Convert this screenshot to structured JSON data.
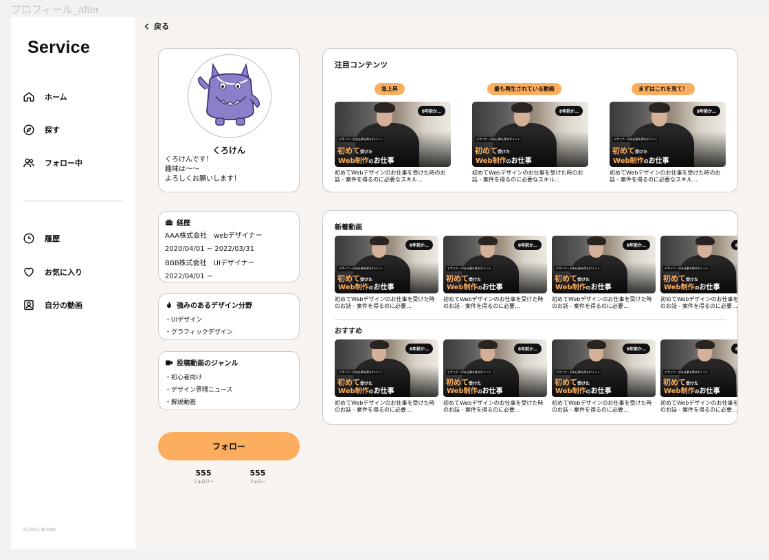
{
  "frame_title": "プロフィール_after",
  "app": {
    "logo": "Service",
    "copyright": "©2022 BONO"
  },
  "sidebar": {
    "items": [
      {
        "label": "ホーム",
        "icon": "home-icon"
      },
      {
        "label": "探す",
        "icon": "compass-icon"
      },
      {
        "label": "フォロー中",
        "icon": "users-icon"
      },
      {
        "label": "履歴",
        "icon": "clock-icon"
      },
      {
        "label": "お気に入り",
        "icon": "heart-icon"
      },
      {
        "label": "自分の動画",
        "icon": "user-square-icon"
      }
    ]
  },
  "back": {
    "label": "戻る",
    "icon": "chevron-left-icon"
  },
  "profile": {
    "name": "くろけん",
    "bio": [
      "くろけんです！",
      "趣味は〜〜",
      "よろしくお願いします！"
    ]
  },
  "career": {
    "title": "経歴",
    "icon": "briefcase-icon",
    "lines": [
      "AAA株式会社　webデザイナー",
      "2020/04/01 ~ 2022/03/31",
      "BBB株式会社　UIデザイナー",
      "2022/04/01 ~"
    ]
  },
  "strengths": {
    "title": "強みのあるデザイン分野",
    "icon": "flame-icon",
    "items": [
      "・UIデザイン",
      "・グラフィックデザイン"
    ]
  },
  "genres": {
    "title": "投稿動画のジャンル",
    "icon": "video-camera-icon",
    "items": [
      "・初心者向け",
      "・デザイン界隈ニュース",
      "・解説動画"
    ]
  },
  "follow_button": "フォロー",
  "stats": [
    {
      "value": "555",
      "label": "フォロワー"
    },
    {
      "value": "555",
      "label": "フォロー"
    }
  ],
  "thumbnail": {
    "bubble": "8年前か…",
    "caption": "デザイナーがお仕事を得るポイント",
    "line1_big": "初めて",
    "line1_small": "受けた",
    "line2_web": "Web制作",
    "line2_no": "の",
    "line2_rest": "お仕事"
  },
  "featured": {
    "title": "注目コンテンツ",
    "items": [
      {
        "tag": "急上昇",
        "title": "初めてWebデザインのお仕事を受けた時のお話 - 案件を得るのに必要なスキル…"
      },
      {
        "tag": "最も再生されている動画",
        "title": "初めてWebデザインのお仕事を受けた時のお話 - 案件を得るのに必要なスキル…"
      },
      {
        "tag": "まずはこれを見て！",
        "title": "初めてWebデザインのお仕事を受けた時のお話 - 案件を得るのに必要なスキル…"
      }
    ]
  },
  "new_videos": {
    "title": "新着動画",
    "items": [
      {
        "title": "初めてWebデザインのお仕事を受けた時のお話 - 案件を得るのに必要…"
      },
      {
        "title": "初めてWebデザインのお仕事を受けた時のお話 - 案件を得るのに必要…"
      },
      {
        "title": "初めてWebデザインのお仕事を受けた時のお話 - 案件を得るのに必要…"
      },
      {
        "title": "初めてWebデザインのお仕事を受けた時のお話 - 案件を得るのに必要…"
      }
    ]
  },
  "recommended": {
    "title": "おすすめ",
    "items": [
      {
        "title": "初めてWebデザインのお仕事を受けた時のお話 - 案件を得るのに必要…"
      },
      {
        "title": "初めてWebデザインのお仕事を受けた時のお話 - 案件を得るのに必要…"
      },
      {
        "title": "初めてWebデザインのお仕事を受けた時のお話 - 案件を得るのに必要…"
      },
      {
        "title": "初めてWebデザインのお仕事を受けた時のお話 - 案件を得るのに必要…"
      }
    ]
  },
  "colors": {
    "accent": "#fcad5e",
    "background": "#f6f3f0",
    "card": "#ffffff",
    "avatar_purple": "#8a7fc9"
  }
}
